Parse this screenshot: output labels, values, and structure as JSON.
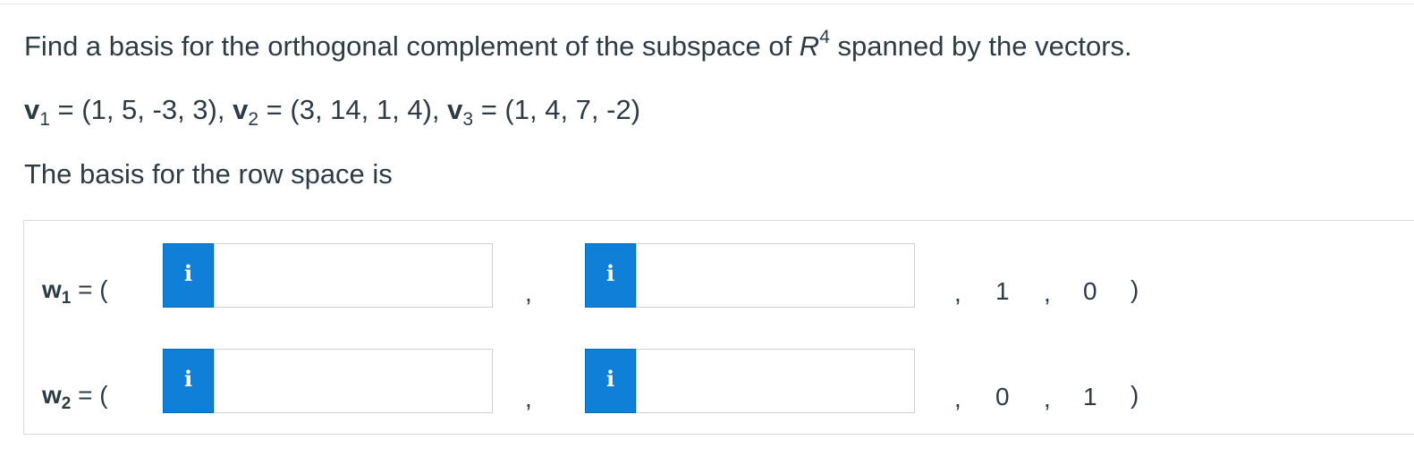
{
  "question": {
    "line1_before": "Find a basis for the orthogonal complement of the subspace of ",
    "space_symbol": "R",
    "space_exponent": "4",
    "line1_after": " spanned by the vectors.",
    "vectors": [
      {
        "name": "v",
        "index": "1",
        "value": " = (1, 5, -3, 3), "
      },
      {
        "name": "v",
        "index": "2",
        "value": " = (3, 14, 1, 4), "
      },
      {
        "name": "v",
        "index": "3",
        "value": " = (1, 4, 7, -2)"
      }
    ],
    "line3": "The basis for the row space is"
  },
  "answer": {
    "rows": [
      {
        "name": "w",
        "index": "1",
        "eq": " = (",
        "info_label": "i",
        "input1_value": "",
        "input2_value": "",
        "comma": ",",
        "fixed1": "1",
        "fixed2": "0",
        "close": ")"
      },
      {
        "name": "w",
        "index": "2",
        "eq": " = (",
        "info_label": "i",
        "input1_value": "",
        "input2_value": "",
        "comma": ",",
        "fixed1": "0",
        "fixed2": "1",
        "close": ")"
      }
    ]
  },
  "colors": {
    "info_button": "#0f7fd8",
    "text": "#2d3b45",
    "border": "#d7dbdf"
  },
  "icons": {
    "info": "info-icon"
  }
}
